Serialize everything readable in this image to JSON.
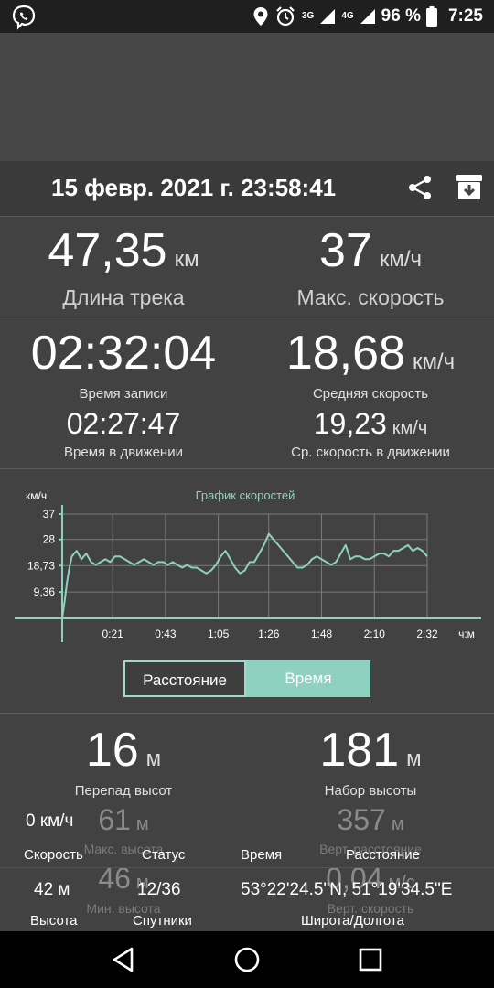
{
  "status_bar": {
    "network_3g": "3G",
    "network_4g": "4G",
    "battery": "96 %",
    "time": "7:25"
  },
  "header": {
    "title": "15 февр. 2021 г. 23:58:41"
  },
  "stats": {
    "track_length": {
      "value": "47,35",
      "unit": "км",
      "label": "Длина трека"
    },
    "max_speed": {
      "value": "37",
      "unit": "км/ч",
      "label": "Макс. скорость"
    },
    "record_time": {
      "value": "02:32:04",
      "label": "Время записи"
    },
    "avg_speed": {
      "value": "18,68",
      "unit": "км/ч",
      "label": "Средняя скорость"
    },
    "moving_time": {
      "value": "02:27:47",
      "label": "Время в движении"
    },
    "moving_avg_speed": {
      "value": "19,23",
      "unit": "км/ч",
      "label": "Ср. скорость в движении"
    }
  },
  "toggle": {
    "distance": "Расстояние",
    "time": "Время",
    "selected": "Время"
  },
  "elevation": {
    "diff": {
      "value": "16",
      "unit": "м",
      "label": "Перепад высот"
    },
    "gain": {
      "value": "181",
      "unit": "м",
      "label": "Набор высоты"
    },
    "max_alt": {
      "value": "61",
      "unit": "м",
      "label": "Макс. высота"
    },
    "vert_dist": {
      "value": "357",
      "unit": "м",
      "label": "Верт. расстояние"
    },
    "min_alt": {
      "value": "46",
      "unit": "м",
      "label": "Мин. высота"
    },
    "vert_speed": {
      "value": "0,04",
      "unit": "м/с",
      "label": "Верт. скорость"
    }
  },
  "overlay": {
    "speed": {
      "value": "0 км/ч",
      "label": "Скорость"
    },
    "status": {
      "label": "Статус"
    },
    "time": {
      "label": "Время"
    },
    "distance": {
      "label": "Расстояние"
    },
    "altitude": {
      "value": "42 м",
      "label": "Высота"
    },
    "satellites": {
      "value": "12/36",
      "label": "Спутники"
    },
    "coords": {
      "value": "53°22'24.5\"N, 51°19'34.5\"E",
      "label": "Широта/Долгота"
    }
  },
  "colors": {
    "accent": "#8fd1c1",
    "background": "#424242",
    "status_bar": "#1f1f1f",
    "nav_bar": "#000000"
  },
  "chart_data": {
    "type": "line",
    "title": "График скоростей",
    "ylabel": "км/ч",
    "xlabel": "ч:м",
    "y_ticks": [
      "37",
      "28",
      "18,73",
      "9,36"
    ],
    "y_tick_values": [
      37,
      28,
      18.73,
      9.36
    ],
    "x_ticks": [
      "0:21",
      "0:43",
      "1:05",
      "1:26",
      "1:48",
      "2:10",
      "2:32"
    ],
    "x_tick_minutes": [
      21,
      43,
      65,
      86,
      108,
      130,
      152
    ],
    "ylim": [
      0,
      37
    ],
    "xlim": [
      0,
      152
    ],
    "grid": true,
    "series": [
      {
        "values_x": [
          0,
          1,
          2,
          3,
          4,
          6,
          8,
          10,
          12,
          14,
          16,
          18,
          20,
          22,
          24,
          26,
          28,
          30,
          32,
          34,
          36,
          38,
          40,
          42,
          44,
          46,
          48,
          50,
          52,
          54,
          56,
          58,
          60,
          62,
          64,
          66,
          68,
          70,
          72,
          74,
          76,
          78,
          80,
          82,
          84,
          86,
          88,
          90,
          92,
          94,
          96,
          98,
          100,
          102,
          104,
          106,
          108,
          110,
          112,
          114,
          116,
          118,
          120,
          122,
          124,
          126,
          128,
          130,
          132,
          134,
          136,
          138,
          140,
          142,
          144,
          146,
          148,
          150,
          152
        ],
        "values_y": [
          0,
          6,
          13,
          18,
          22,
          24,
          21,
          23,
          20,
          19,
          20,
          21,
          20,
          22,
          22,
          21,
          20,
          19,
          20,
          21,
          20,
          19,
          20,
          20,
          19,
          20,
          19,
          18,
          19,
          18,
          18,
          17,
          16,
          17,
          19,
          22,
          24,
          21,
          18,
          16,
          17,
          20,
          20,
          23,
          26,
          30,
          28,
          26,
          24,
          22,
          20,
          18,
          18,
          19,
          21,
          22,
          21,
          20,
          19,
          20,
          23,
          26,
          21,
          22,
          22,
          21,
          21,
          22,
          23,
          23,
          22,
          24,
          24,
          25,
          26,
          24,
          25,
          24,
          22
        ]
      }
    ]
  }
}
